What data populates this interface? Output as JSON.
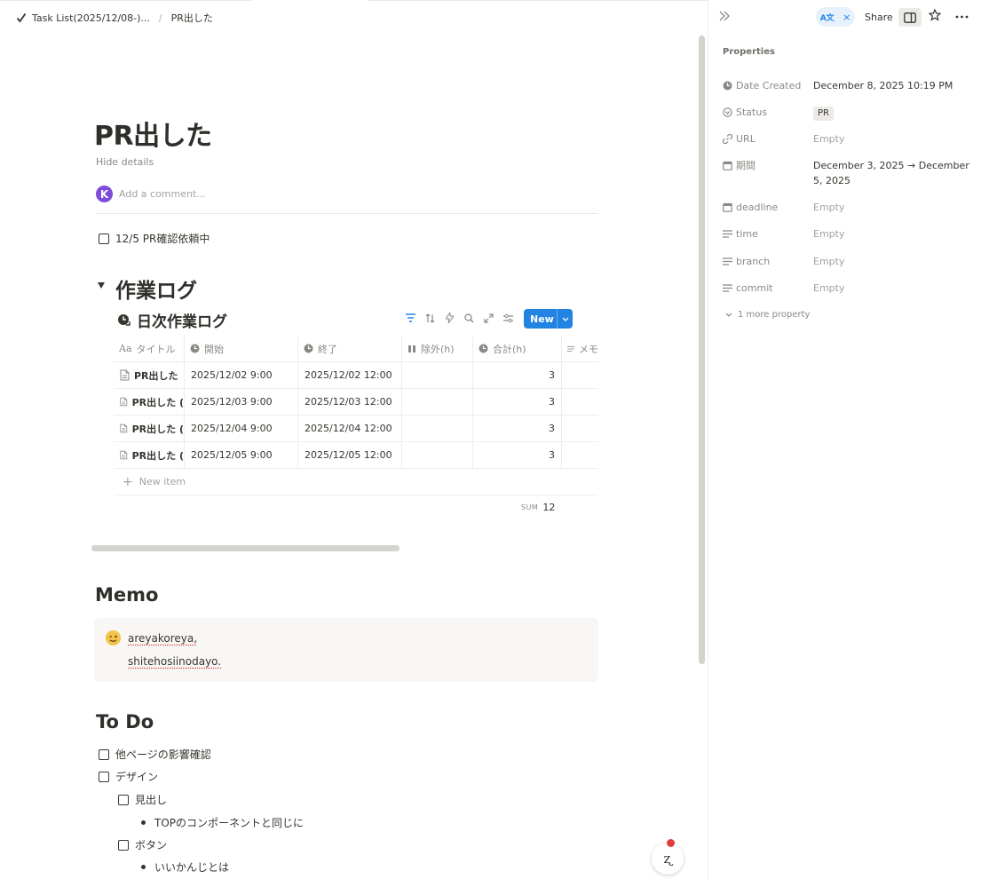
{
  "breadcrumb": {
    "parent": "Task List(2025/12/08-)...",
    "current": "PR出した"
  },
  "page": {
    "title": "PR出した",
    "hide_details": "Hide details",
    "avatar_letter": "K",
    "comment_placeholder": "Add a comment..."
  },
  "top_todo": {
    "label": "12/5 PR確認依頼中"
  },
  "work_log": {
    "heading": "作業ログ",
    "db_title": "日次作業ログ",
    "new_label": "New",
    "columns": [
      "タイトル",
      "開始",
      "終了",
      "除外(h)",
      "合計(h)",
      "メモ"
    ],
    "rows": [
      {
        "title": "PR出した",
        "start": "2025/12/02 9:00",
        "end": "2025/12/02 12:00",
        "excluded": "",
        "total": "3"
      },
      {
        "title": "PR出した (",
        "start": "2025/12/03 9:00",
        "end": "2025/12/03 12:00",
        "excluded": "",
        "total": "3"
      },
      {
        "title": "PR出した (",
        "start": "2025/12/04 9:00",
        "end": "2025/12/04 12:00",
        "excluded": "",
        "total": "3"
      },
      {
        "title": "PR出した (",
        "start": "2025/12/05 9:00",
        "end": "2025/12/05 12:00",
        "excluded": "",
        "total": "3"
      }
    ],
    "new_item": "New item",
    "sum_label": "SUM",
    "sum_value": "12"
  },
  "memo": {
    "heading": "Memo",
    "line1": "areyakoreya,",
    "line2": "shitehosiinodayo."
  },
  "todo_section": {
    "heading": "To Do",
    "item1": "他ページの影響確認",
    "item2": "デザイン",
    "item2a": "見出し",
    "item2a_bullet": "TOPのコンポーネントと同じに",
    "item2b": "ボタン",
    "item2b_bullet": "いいかんじとは"
  },
  "help_glyph": "ʐ",
  "topbar": {
    "share": "Share"
  },
  "properties": {
    "heading": "Properties",
    "items": [
      {
        "name": "Date Created",
        "value": "December 8, 2025 10:19 PM",
        "icon": "clock-icon"
      },
      {
        "name": "Status",
        "value": "PR",
        "icon": "status-icon"
      },
      {
        "name": "URL",
        "value": "Empty",
        "icon": "link-icon"
      },
      {
        "name": "期間",
        "value": "December 3, 2025 → December 5, 2025",
        "icon": "calendar-icon"
      },
      {
        "name": "deadline",
        "value": "Empty",
        "icon": "calendar-icon"
      },
      {
        "name": "time",
        "value": "Empty",
        "icon": "text-icon"
      },
      {
        "name": "branch",
        "value": "Empty",
        "icon": "text-icon"
      },
      {
        "name": "commit",
        "value": "Empty",
        "icon": "text-icon"
      }
    ],
    "more": "1 more property"
  },
  "colors": {
    "accent": "#2383e2",
    "avatar": "#7d4cdb",
    "text": "#37352f"
  }
}
